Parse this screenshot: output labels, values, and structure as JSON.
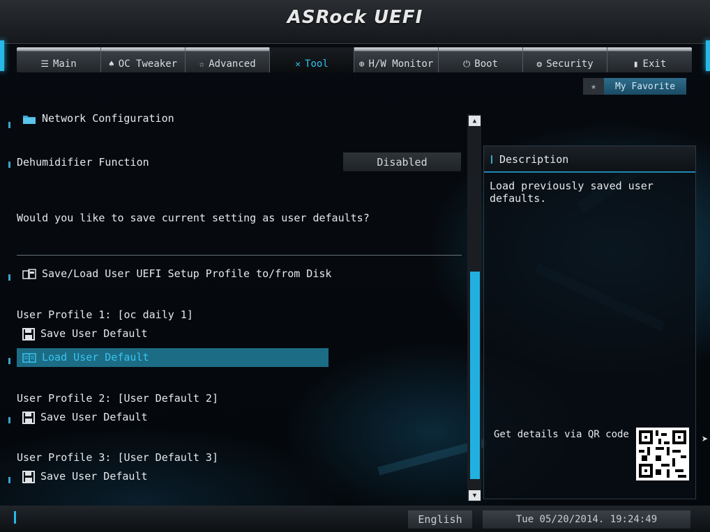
{
  "header": {
    "logo": "ASRock UEFI"
  },
  "tabs": [
    {
      "label": "Main",
      "icon": "list-icon"
    },
    {
      "label": "OC Tweaker",
      "icon": "rocket-icon"
    },
    {
      "label": "Advanced",
      "icon": "star-icon"
    },
    {
      "label": "Tool",
      "icon": "tools-icon",
      "active": true
    },
    {
      "label": "H/W Monitor",
      "icon": "monitor-icon"
    },
    {
      "label": "Boot",
      "icon": "power-icon"
    },
    {
      "label": "Security",
      "icon": "shield-icon"
    },
    {
      "label": "Exit",
      "icon": "exit-door-icon"
    }
  ],
  "favorite": {
    "label": "My Favorite"
  },
  "main": {
    "network_config": "Network Configuration",
    "dehumidifier_label": "Dehumidifier Function",
    "dehumidifier_value": "Disabled",
    "question": "Would you like to save current setting as user defaults?",
    "disk_profile": "Save/Load User UEFI Setup Profile to/from Disk",
    "profile1": "User Profile 1: [oc daily 1]",
    "profile1_save": "Save User Default",
    "profile1_load": "Load User Default",
    "profile2": "User Profile 2: [User Default 2]",
    "profile2_save": "Save User Default",
    "profile3": "User Profile 3: [User Default 3]",
    "profile3_save": "Save User Default"
  },
  "description": {
    "title": "Description",
    "text": "Load previously saved user defaults.",
    "qr_label": "Get details via QR code"
  },
  "footer": {
    "language": "English",
    "datetime": "Tue 05/20/2014. 19:24:49"
  },
  "colors": {
    "accent": "#22b0e0",
    "selection": "#1c6c85",
    "active_tab_text": "#30c4f0"
  }
}
